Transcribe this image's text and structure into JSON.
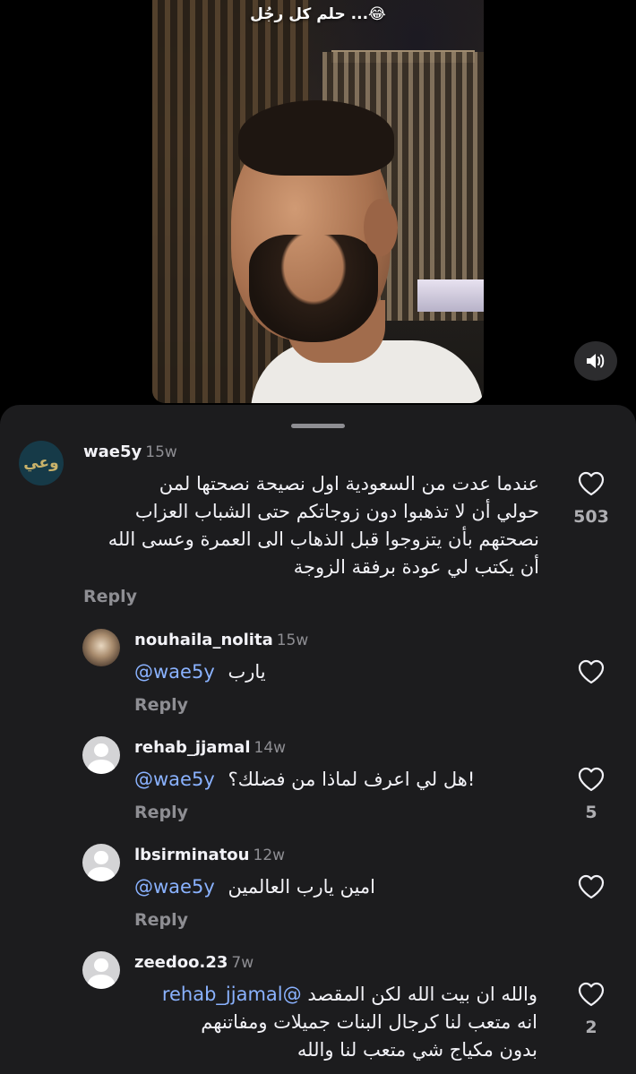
{
  "video": {
    "caption": "حلم كل رجُل ...😂",
    "mute_icon": "speaker-icon"
  },
  "comments": [
    {
      "username": "wae5y",
      "time": "15w",
      "avatar_text": "وعي",
      "lines": [
        "عندما عدت من السعودية اول نصيحة نصحتها لمن",
        "حولي أن لا تذهبوا دون زوجاتكم حتى الشباب العزاب",
        "نصحتهم بأن يتزوجوا قبل الذهاب الى العمرة وعسى الله",
        "أن يكتب لي عودة برفقة الزوجة"
      ],
      "reply_label": "Reply",
      "likes": "503"
    },
    {
      "username": "nouhaila_nolita",
      "time": "15w",
      "mention": "@wae5y",
      "text": "يارب",
      "reply_label": "Reply",
      "likes": ""
    },
    {
      "username": "rehab_jjamal",
      "time": "14w",
      "mention": "@wae5y",
      "text": "هل لي اعرف لماذا من فضلك؟!",
      "reply_label": "Reply",
      "likes": "5"
    },
    {
      "username": "lbsirminatou",
      "time": "12w",
      "mention": "@wae5y",
      "text": "امين يارب العالمين",
      "reply_label": "Reply",
      "likes": ""
    },
    {
      "username": "zeedoo.23",
      "time": "7w",
      "mention": "@rehab_jjamal",
      "lines": [
        "والله ان بيت الله لكن المقصد",
        "انه متعب لنا كرجال البنات جميلات ومفاتنهم",
        "بدون مكياج شي متعب لنا والله"
      ],
      "likes": "2"
    }
  ]
}
